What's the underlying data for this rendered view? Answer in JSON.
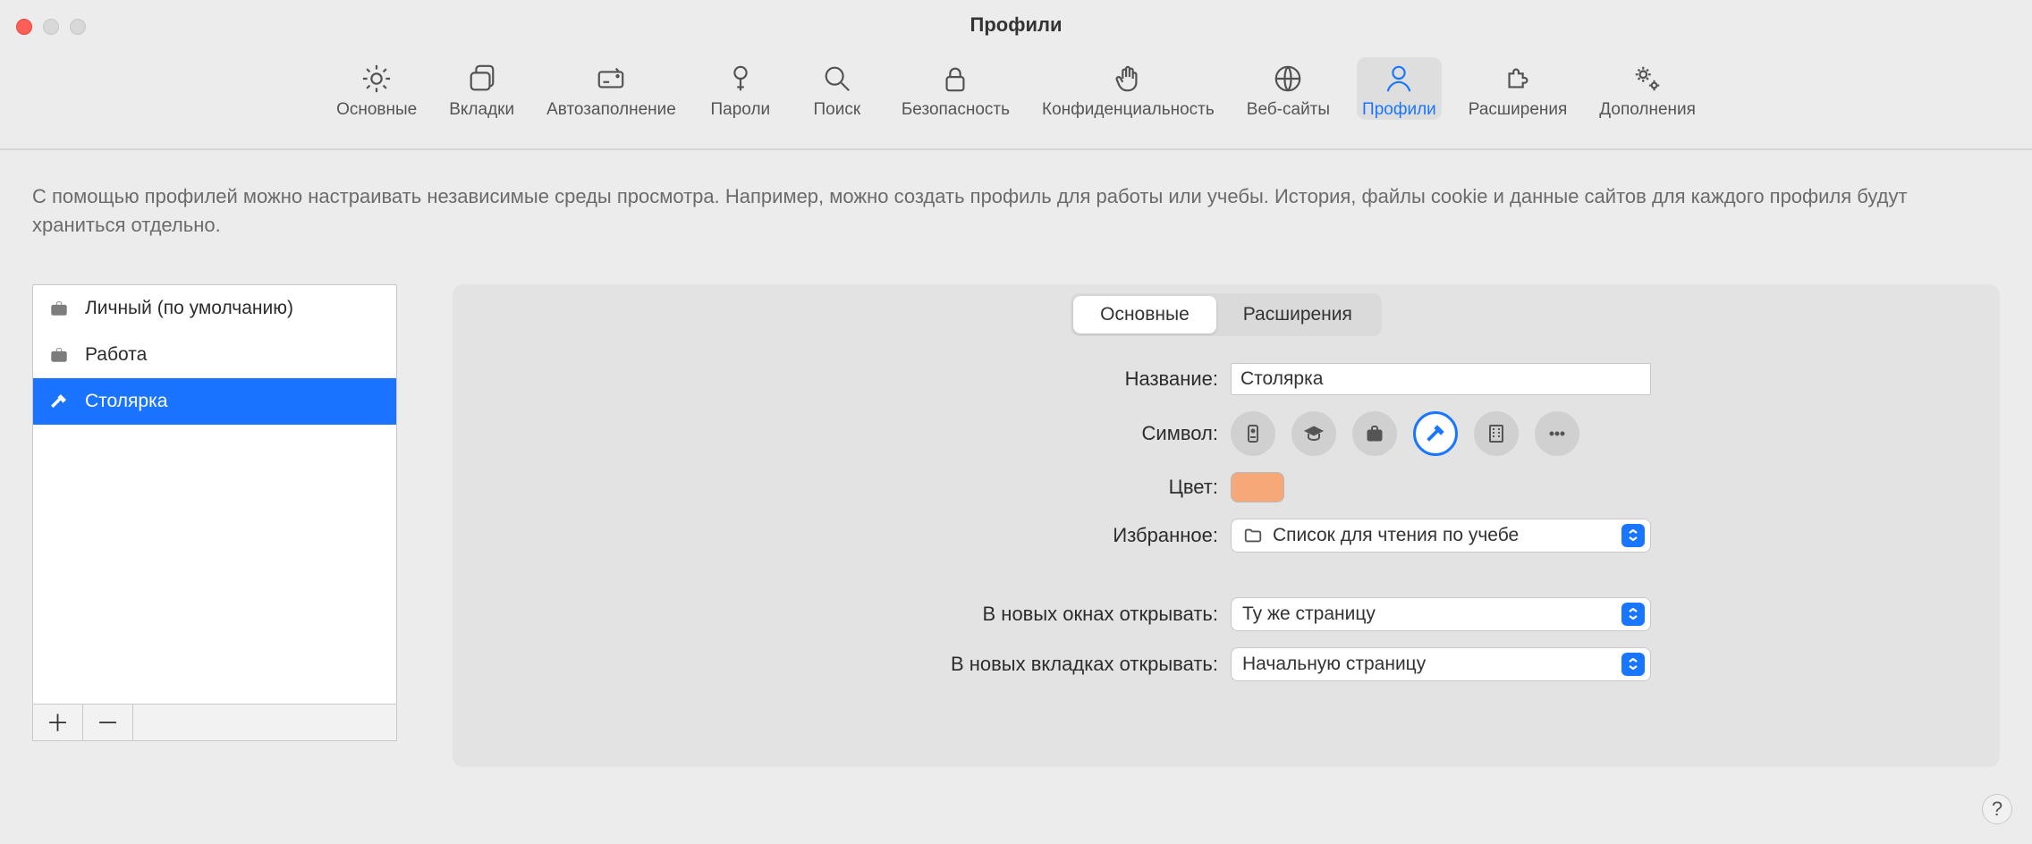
{
  "window": {
    "title": "Профили"
  },
  "toolbar": {
    "items": [
      {
        "label": "Основные"
      },
      {
        "label": "Вкладки"
      },
      {
        "label": "Автозаполнение"
      },
      {
        "label": "Пароли"
      },
      {
        "label": "Поиск"
      },
      {
        "label": "Безопасность"
      },
      {
        "label": "Конфиденциальность"
      },
      {
        "label": "Веб-сайты"
      },
      {
        "label": "Профили"
      },
      {
        "label": "Расширения"
      },
      {
        "label": "Дополнения"
      }
    ],
    "active_index": 8
  },
  "help_text": "С помощью профилей можно настраивать независимые среды просмотра. Например, можно создать профиль для работы или учебы. История, файлы cookie и данные сайтов для каждого профиля будут храниться отдельно.",
  "sidebar": {
    "items": [
      {
        "label": "Личный (по умолчанию)",
        "icon": "briefcase"
      },
      {
        "label": "Работа",
        "icon": "briefcase"
      },
      {
        "label": "Столярка",
        "icon": "hammer"
      }
    ],
    "selected_index": 2,
    "add_label": "＋",
    "remove_label": "－"
  },
  "detail": {
    "segments": {
      "main": "Основные",
      "extensions": "Расширения",
      "active": "main"
    },
    "labels": {
      "name": "Название:",
      "symbol": "Символ:",
      "color": "Цвет:",
      "favorites": "Избранное:",
      "new_windows": "В новых окнах открывать:",
      "new_tabs": "В новых вкладках открывать:"
    },
    "name_value": "Столярка",
    "symbols": [
      "badge",
      "graduation",
      "briefcase",
      "hammer",
      "building",
      "more"
    ],
    "symbol_selected_index": 3,
    "color_value": "#f6a878",
    "favorites_value": "Список для чтения по учебе",
    "new_windows_value": "Ту же страницу",
    "new_tabs_value": "Начальную страницу"
  },
  "help_button": "?"
}
